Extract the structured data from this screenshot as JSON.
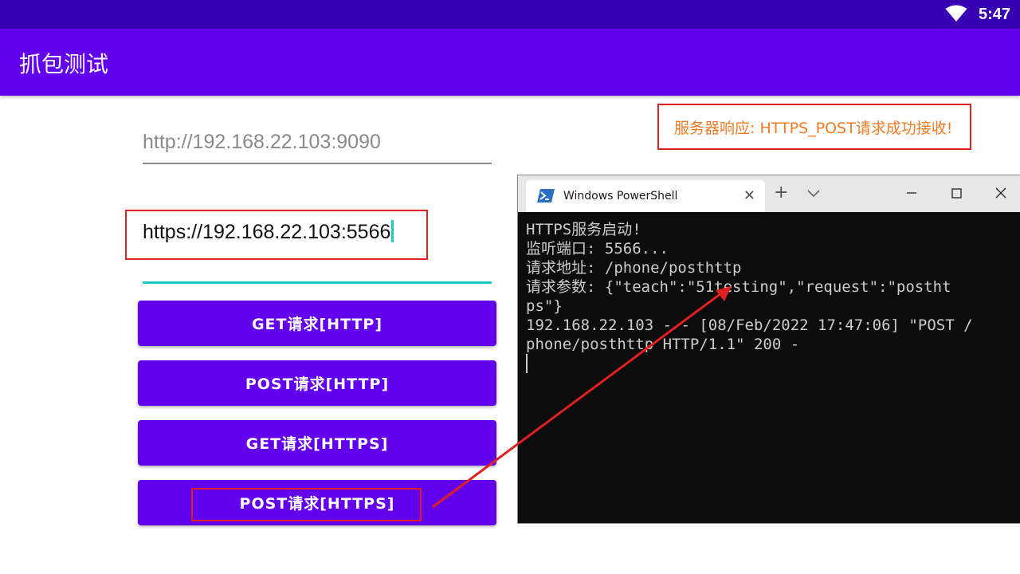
{
  "status_bar": {
    "time": "5:47"
  },
  "app_bar": {
    "title": "抓包测试"
  },
  "form": {
    "http_url": "http://192.168.22.103:9090",
    "https_url": "https://192.168.22.103:5566"
  },
  "buttons": {
    "get_http": "GET请求[HTTP]",
    "post_http": "POST请求[HTTP]",
    "get_https": "GET请求[HTTPS]",
    "post_https": "POST请求[HTTPS]"
  },
  "response": {
    "text": "服务器响应: HTTPS_POST请求成功接收!"
  },
  "powershell": {
    "tab_title": "Windows PowerShell",
    "lines": [
      "HTTPS服务启动!",
      "监听端口: 5566...",
      "请求地址: /phone/posthttp",
      "请求参数: {\"teach\":\"51testing\",\"request\":\"postht",
      "ps\"}",
      "192.168.22.103 - - [08/Feb/2022 17:47:06] \"POST /",
      "phone/posthttp HTTP/1.1\" 200 -"
    ]
  },
  "colors": {
    "status_bar": "#3700b3",
    "primary": "#6200ee",
    "accent": "#1ec8c8",
    "annotation": "#e02020",
    "response_text": "#f07b24"
  }
}
